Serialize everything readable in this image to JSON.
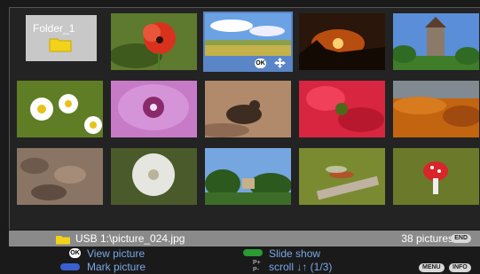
{
  "grid": {
    "folder": {
      "label": "Folder_1",
      "icon": "folder-icon"
    },
    "selected": {
      "ok_label": "OK",
      "move_icon": "move-arrows-icon"
    }
  },
  "status": {
    "path": "USB 1:\\picture_024.jpg",
    "count": "38 pictures",
    "end_key": "END"
  },
  "legend": {
    "ok_key": "OK",
    "view": "View picture",
    "mark": "Mark picture",
    "slideshow": "Slide show",
    "scroll": "scroll ↓↑ (1/3)",
    "p_plus": "P+",
    "p_minus": "P-",
    "menu_key": "MENU",
    "info_key": "INFO"
  },
  "colors": {
    "selection": "#5a85c6",
    "legend_text": "#7aa8e6",
    "green_key": "#2a9a32",
    "blue_key": "#3a5fd0"
  }
}
